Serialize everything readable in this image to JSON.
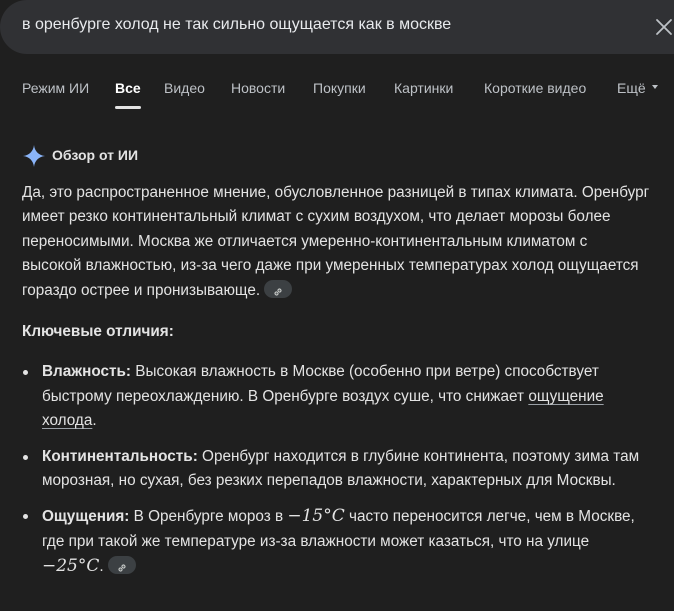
{
  "search": {
    "query": "в оренбурге холод не так сильно ощущается как в москве",
    "clear_icon": "close-icon"
  },
  "tabs": [
    {
      "label": "Режим ИИ",
      "active": false
    },
    {
      "label": "Все",
      "active": true
    },
    {
      "label": "Видео",
      "active": false
    },
    {
      "label": "Новости",
      "active": false
    },
    {
      "label": "Покупки",
      "active": false
    },
    {
      "label": "Картинки",
      "active": false
    },
    {
      "label": "Короткие видео",
      "active": false
    },
    {
      "label": "Ещё",
      "active": false
    }
  ],
  "ai_overview": {
    "icon": "sparkle-icon",
    "title": "Обзор от ИИ",
    "intro": "Да, это распространенное мнение, обусловленное разницей в типах климата. Оренбург имеет резко континентальный климат с сухим воздухом, что делает морозы более переносимыми. Москва же отличается умеренно-континентальным климатом с высокой влажностью, из-за чего даже при умеренных температурах холод ощущается гораздо острее и пронизывающе.",
    "section_title": "Ключевые отличия:",
    "bullets": [
      {
        "term": "Влажность:",
        "text": " Высокая влажность в Москве (особенно при ветре) способствует быстрому переохлаждению. В Оренбурге воздух суше, что снижает ",
        "link_text": "ощущение холода",
        "text_end": "."
      },
      {
        "term": "Континентальность:",
        "text": " Оренбург находится в глубине континента, поэтому зима там морозная, но сухая, без резких перепадов влажности, характерных для Москвы."
      },
      {
        "term": "Ощущения:",
        "text_a": " В Оренбурге мороз в ",
        "temp_a": "−15°C",
        "text_b": " часто переносится легче, чем в Москве, где при такой же температуре из-за влажности может казаться, что на улице ",
        "temp_b": "−25°C",
        "text_c": "."
      }
    ]
  },
  "colors": {
    "background": "#1f1f1f",
    "search_bg": "#303134",
    "text": "#e3e3e3",
    "tab_text": "#bdc1c6",
    "sparkle_blue": "#8ab4f8"
  }
}
